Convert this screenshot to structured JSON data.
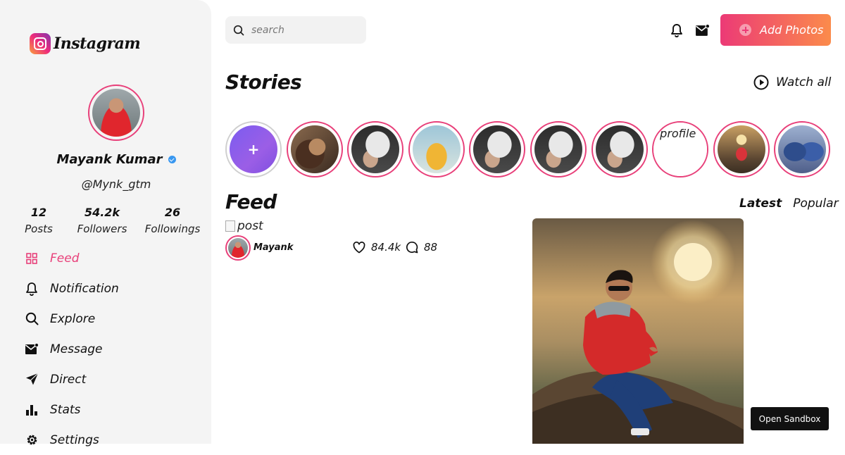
{
  "app": {
    "logo_text": "Instagram"
  },
  "profile": {
    "name": "Mayank Kumar",
    "handle": "@Mynk_gtm",
    "stats": [
      {
        "value": "12",
        "label": "Posts"
      },
      {
        "value": "54.2k",
        "label": "Followers"
      },
      {
        "value": "26",
        "label": "Followings"
      }
    ]
  },
  "nav": [
    {
      "label": "Feed",
      "icon": "grid-icon",
      "active": true
    },
    {
      "label": "Notification",
      "icon": "bell-icon",
      "active": false
    },
    {
      "label": "Explore",
      "icon": "search-icon",
      "active": false
    },
    {
      "label": "Message",
      "icon": "mail-icon",
      "active": false
    },
    {
      "label": "Direct",
      "icon": "send-icon",
      "active": false
    },
    {
      "label": "Stats",
      "icon": "bar-chart-icon",
      "active": false
    },
    {
      "label": "Settings",
      "icon": "gear-icon",
      "active": false
    }
  ],
  "topbar": {
    "search_placeholder": "search",
    "add_photos_label": "Add Photos"
  },
  "stories": {
    "heading": "Stories",
    "watch_all_label": "Watch all",
    "broken_image_alt": "profile"
  },
  "feed": {
    "heading": "Feed",
    "tabs": [
      {
        "label": "Latest",
        "selected": true
      },
      {
        "label": "Popular",
        "selected": false
      }
    ],
    "post": {
      "broken_image_alt": "post",
      "user": "Mayank",
      "likes": "84.4k",
      "comments": "88"
    }
  },
  "sandbox_label": "Open Sandbox",
  "colors": {
    "accent": "#e8407a",
    "button_gradient_start": "#ec3a76",
    "button_gradient_end": "#fb8b4b",
    "sidebar_bg": "#f4f4f4"
  }
}
